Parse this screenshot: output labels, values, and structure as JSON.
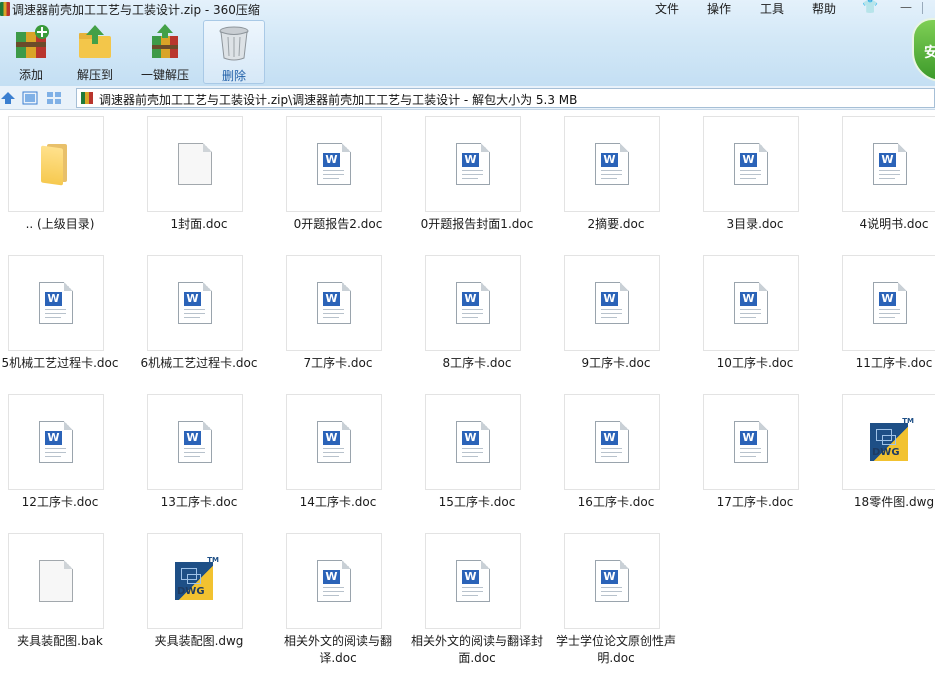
{
  "window": {
    "title": "调速器前壳加工工艺与工装设计.zip - 360压缩",
    "menu": [
      "文件",
      "操作",
      "工具",
      "帮助"
    ],
    "minimize": "—"
  },
  "toolbar": {
    "add": "添加",
    "extract_to": "解压到",
    "one_click_extract": "一键解压",
    "delete": "删除",
    "shield_text": "安"
  },
  "address": {
    "path": "调速器前壳加工工艺与工装设计.zip\\调速器前壳加工工艺与工装设计 - 解包大小为 5.3 MB"
  },
  "files": [
    {
      "name": ".. (上级目录)",
      "icon": "folder-icon"
    },
    {
      "name": "1封面.doc",
      "icon": "blank-file-icon"
    },
    {
      "name": "0开题报告2.doc",
      "icon": "word-doc-icon"
    },
    {
      "name": "0开题报告封面1.doc",
      "icon": "word-doc-icon"
    },
    {
      "name": "2摘要.doc",
      "icon": "word-doc-icon"
    },
    {
      "name": "3目录.doc",
      "icon": "word-doc-icon"
    },
    {
      "name": "4说明书.doc",
      "icon": "word-doc-icon"
    },
    {
      "name": "5机械工艺过程卡.doc",
      "icon": "word-doc-icon"
    },
    {
      "name": "6机械工艺过程卡.doc",
      "icon": "word-doc-icon"
    },
    {
      "name": "7工序卡.doc",
      "icon": "word-doc-icon"
    },
    {
      "name": "8工序卡.doc",
      "icon": "word-doc-icon"
    },
    {
      "name": "9工序卡.doc",
      "icon": "word-doc-icon"
    },
    {
      "name": "10工序卡.doc",
      "icon": "word-doc-icon"
    },
    {
      "name": "11工序卡.doc",
      "icon": "word-doc-icon"
    },
    {
      "name": "12工序卡.doc",
      "icon": "word-doc-icon"
    },
    {
      "name": "13工序卡.doc",
      "icon": "word-doc-icon"
    },
    {
      "name": "14工序卡.doc",
      "icon": "word-doc-icon"
    },
    {
      "name": "15工序卡.doc",
      "icon": "word-doc-icon"
    },
    {
      "name": "16工序卡.doc",
      "icon": "word-doc-icon"
    },
    {
      "name": "17工序卡.doc",
      "icon": "word-doc-icon"
    },
    {
      "name": "18零件图.dwg",
      "icon": "dwg-icon"
    },
    {
      "name": "夹具装配图.bak",
      "icon": "blank-file-icon"
    },
    {
      "name": "夹具装配图.dwg",
      "icon": "dwg-icon"
    },
    {
      "name": "相关外文的阅读与翻译.doc",
      "icon": "word-doc-icon"
    },
    {
      "name": "相关外文的阅读与翻译封面.doc",
      "icon": "word-doc-icon"
    },
    {
      "name": "学士学位论文原创性声明.doc",
      "icon": "word-doc-icon"
    }
  ],
  "icon_labels": {
    "word": "W",
    "dwg": "DWG",
    "tm": "TM"
  }
}
